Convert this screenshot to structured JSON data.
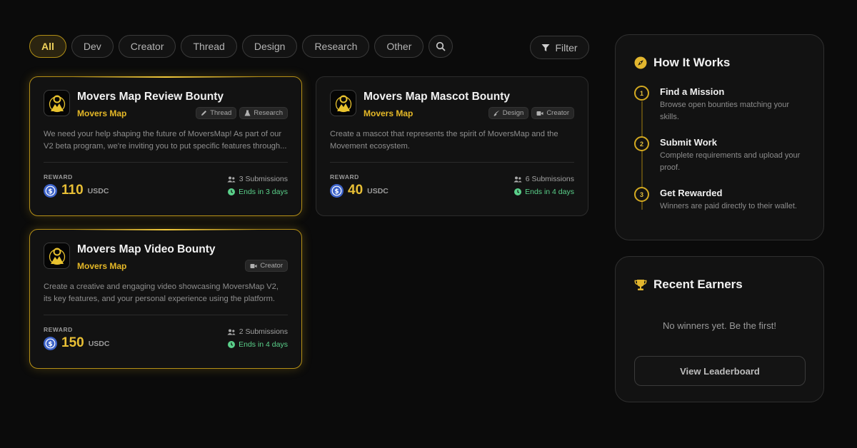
{
  "filters": {
    "categories": [
      "All",
      "Dev",
      "Creator",
      "Thread",
      "Design",
      "Research",
      "Other"
    ],
    "active": "All",
    "search_icon": "search-icon",
    "filter_label": "Filter",
    "filter_icon": "funnel-icon"
  },
  "bounties": [
    {
      "title": "Movers Map Review Bounty",
      "org": "Movers Map",
      "tags": [
        {
          "label": "Thread",
          "icon": "pencil-icon"
        },
        {
          "label": "Research",
          "icon": "flask-icon"
        }
      ],
      "description": "We need your help shaping the future of MoversMap! As part of our V2 beta program, we're inviting you to put specific features through...",
      "reward_label": "REWARD",
      "amount": "110",
      "unit": "USDC",
      "submissions": "3 Submissions",
      "ends": "Ends in 3 days",
      "featured": true
    },
    {
      "title": "Movers Map Mascot Bounty",
      "org": "Movers Map",
      "tags": [
        {
          "label": "Design",
          "icon": "brush-icon"
        },
        {
          "label": "Creator",
          "icon": "video-icon"
        }
      ],
      "description": "Create a mascot that represents the spirit of MoversMap and the Movement ecosystem.",
      "reward_label": "REWARD",
      "amount": "40",
      "unit": "USDC",
      "submissions": "6 Submissions",
      "ends": "Ends in 4 days",
      "featured": false
    },
    {
      "title": "Movers Map Video Bounty",
      "org": "Movers Map",
      "tags": [
        {
          "label": "Creator",
          "icon": "video-icon"
        }
      ],
      "description": "Create a creative and engaging video showcasing MoversMap V2, its key features, and your personal experience using the platform. Your...",
      "reward_label": "REWARD",
      "amount": "150",
      "unit": "USDC",
      "submissions": "2 Submissions",
      "ends": "Ends in 4 days",
      "featured": true
    }
  ],
  "how_it_works": {
    "title": "How It Works",
    "icon": "compass-icon",
    "steps": [
      {
        "num": "1",
        "title": "Find a Mission",
        "desc": "Browse open bounties matching your skills."
      },
      {
        "num": "2",
        "title": "Submit Work",
        "desc": "Complete requirements and upload your proof."
      },
      {
        "num": "3",
        "title": "Get Rewarded",
        "desc": "Winners are paid directly to their wallet."
      }
    ]
  },
  "recent_earners": {
    "title": "Recent Earners",
    "icon": "trophy-icon",
    "empty_text": "No winners yet. Be the first!",
    "button_label": "View Leaderboard"
  },
  "colors": {
    "accent": "#e5b827",
    "green": "#5ad08a",
    "background": "#0b0b0b",
    "card": "#121212"
  }
}
